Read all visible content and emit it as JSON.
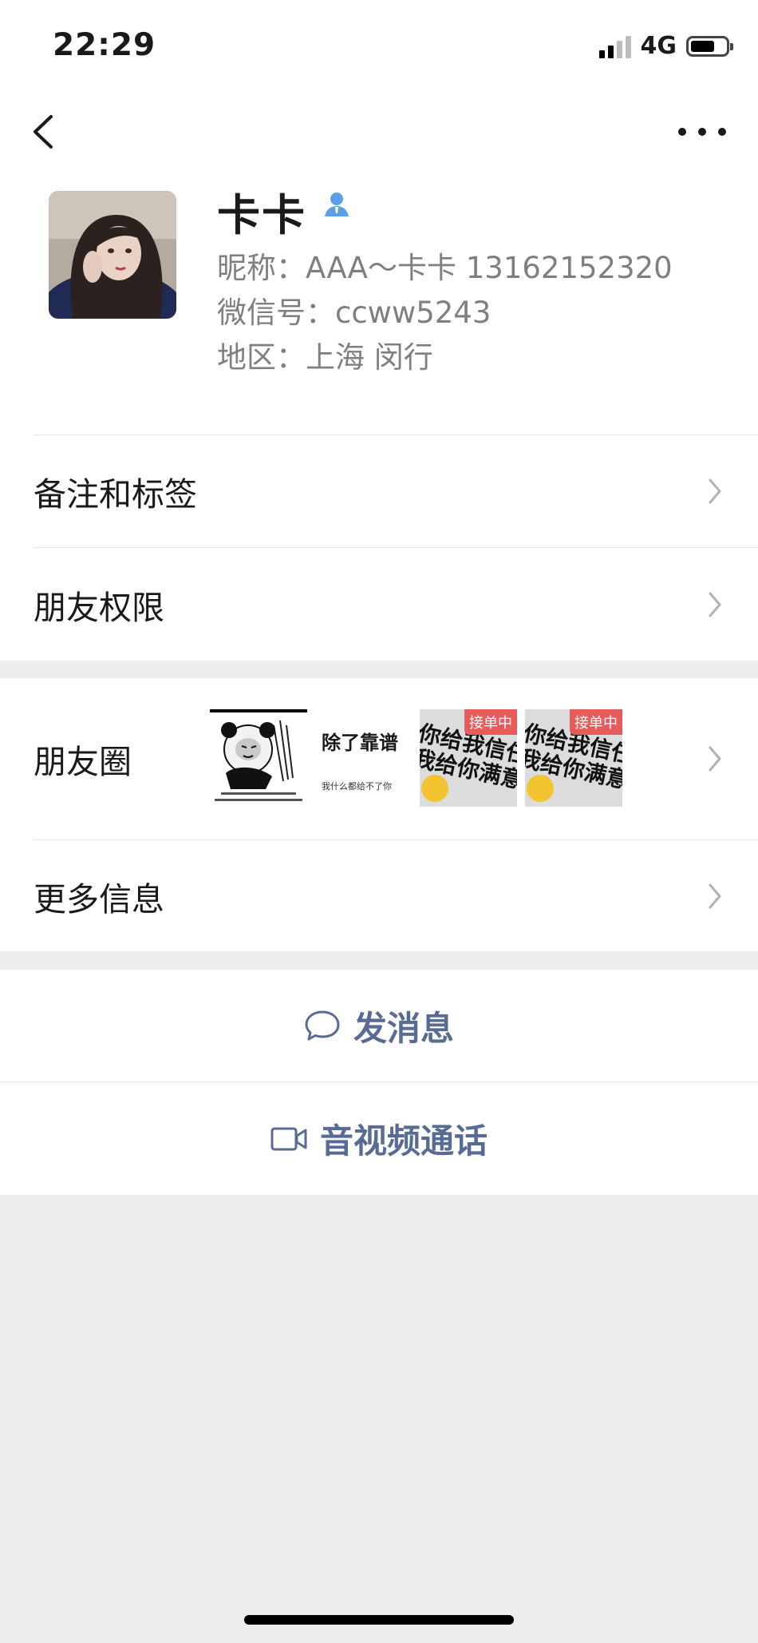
{
  "status_bar": {
    "time": "22:29",
    "network": "4G",
    "battery_level": 0.7
  },
  "profile": {
    "name": "卡卡",
    "nickname": "昵称：AAA～卡卡 13162152320",
    "wechat_id": "微信号：ccww5243",
    "region": "地区：上海 闵行"
  },
  "menu": {
    "remark_tags": "备注和标签",
    "friend_permissions": "朋友权限",
    "moments": "朋友圈",
    "more_info": "更多信息"
  },
  "moments_thumbs": {
    "thumb2_line1": "除了靠谱",
    "thumb2_line2": "我什么都给不了你",
    "stamp_tag": "接单中",
    "stamp_text_line1": "你给我信任",
    "stamp_text_line2": "我给你满意"
  },
  "actions": {
    "send_message": "发消息",
    "video_call": "音视频通话"
  },
  "colors": {
    "link": "#576b95",
    "background": "#ededed",
    "stamp_red": "#e65c5c"
  }
}
